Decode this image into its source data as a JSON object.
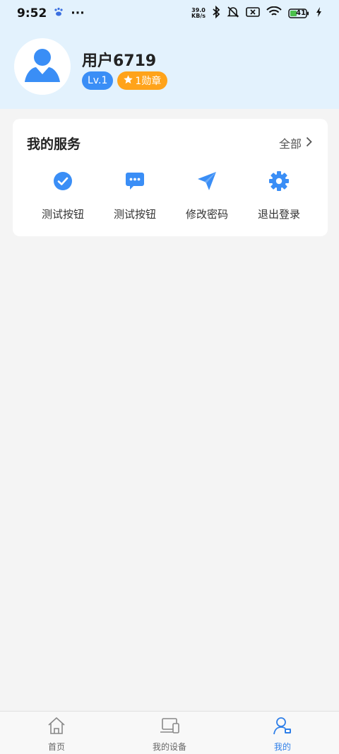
{
  "status_bar": {
    "time": "9:52",
    "more_indicator": "···",
    "net_speed_value": "39.0",
    "net_speed_unit": "KB/s",
    "battery_level": "41"
  },
  "profile": {
    "username": "用户6719",
    "level": "Lv.1",
    "medals": "1勋章"
  },
  "services": {
    "title": "我的服务",
    "more_label": "全部",
    "items": [
      {
        "label": "测试按钮",
        "icon": "check-circle-icon"
      },
      {
        "label": "测试按钮",
        "icon": "chat-bubble-icon"
      },
      {
        "label": "修改密码",
        "icon": "paper-plane-icon"
      },
      {
        "label": "退出登录",
        "icon": "gear-icon"
      }
    ]
  },
  "tabs": [
    {
      "label": "首页",
      "icon": "home-icon",
      "active": false
    },
    {
      "label": "我的设备",
      "icon": "devices-icon",
      "active": false
    },
    {
      "label": "我的",
      "icon": "user-icon",
      "active": true
    }
  ],
  "colors": {
    "accent": "#3a8ef6",
    "header_bg": "#e3f2fd",
    "medal": "#ffa31a",
    "page_bg": "#f4f4f4"
  }
}
